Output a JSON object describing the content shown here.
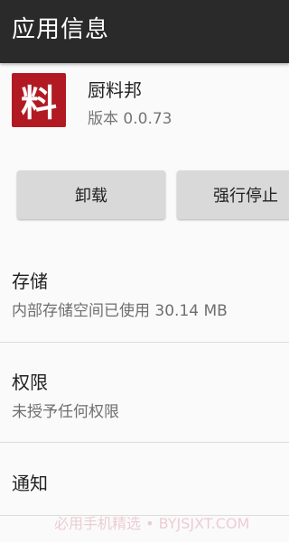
{
  "appbar": {
    "title": "应用信息"
  },
  "app": {
    "icon_glyph": "料",
    "icon_color": "#b11a22",
    "name": "厨料邦",
    "version": "版本 0.0.73"
  },
  "buttons": {
    "uninstall_label": "卸载",
    "force_stop_label": "强行停止"
  },
  "sections": {
    "storage": {
      "label": "存储",
      "summary": "内部存储空间已使用 30.14 MB"
    },
    "permissions": {
      "label": "权限",
      "summary": "未授予任何权限"
    },
    "notifications": {
      "label": "通知"
    }
  },
  "watermark": "必用手机精选 • BYJSJXT.COM"
}
